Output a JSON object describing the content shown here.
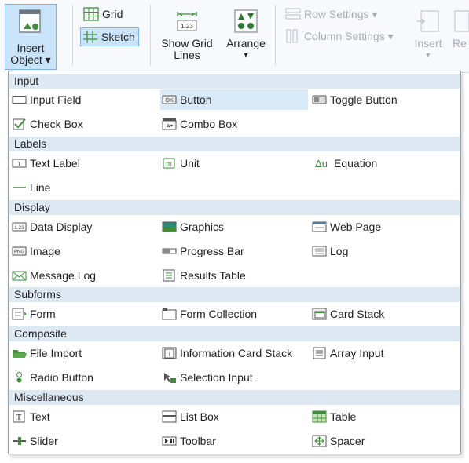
{
  "ribbon": {
    "insert_object": "Insert\nObject ▾",
    "insert_object_l1": "Insert",
    "insert_object_l2": "Object ▾",
    "grid": "Grid",
    "sketch": "Sketch",
    "show_grid_lines_l1": "Show Grid",
    "show_grid_lines_l2": "Lines",
    "arrange": "Arrange",
    "arrange_arrow": "▾",
    "row_settings": "Row Settings ▾",
    "column_settings": "Column Settings ▾",
    "insert": "Insert",
    "insert_arrow": "▾",
    "re": "Re",
    "show_grid_badge": "1.23"
  },
  "menu": {
    "categories": [
      "Input",
      "Labels",
      "Display",
      "Subforms",
      "Composite",
      "Miscellaneous"
    ],
    "items": {
      "input_field": "Input Field",
      "button": "Button",
      "toggle_button": "Toggle Button",
      "check_box": "Check Box",
      "combo_box": "Combo Box",
      "text_label": "Text Label",
      "unit": "Unit",
      "equation": "Equation",
      "line": "Line",
      "data_display": "Data Display",
      "graphics": "Graphics",
      "web_page": "Web Page",
      "image": "Image",
      "progress_bar": "Progress Bar",
      "log": "Log",
      "message_log": "Message Log",
      "results_table": "Results Table",
      "form": "Form",
      "form_collection": "Form Collection",
      "card_stack": "Card Stack",
      "file_import": "File Import",
      "information_card_stack": "Information Card Stack",
      "array_input": "Array Input",
      "radio_button": "Radio Button",
      "selection_input": "Selection Input",
      "text": "Text",
      "list_box": "List Box",
      "table": "Table",
      "slider": "Slider",
      "toolbar": "Toolbar",
      "spacer": "Spacer"
    },
    "icon_text": {
      "ok": "OK",
      "png": "PNG",
      "data": "1.23",
      "m": "m",
      "t": "T",
      "delta_u": "Δu"
    },
    "highlighted_item": "Button"
  },
  "colors": {
    "accent_green": "#3f8f3a",
    "highlight": "#d9eaf9",
    "category_bg": "#dde8f3",
    "ribbon_selected": "#c9e3f9"
  }
}
